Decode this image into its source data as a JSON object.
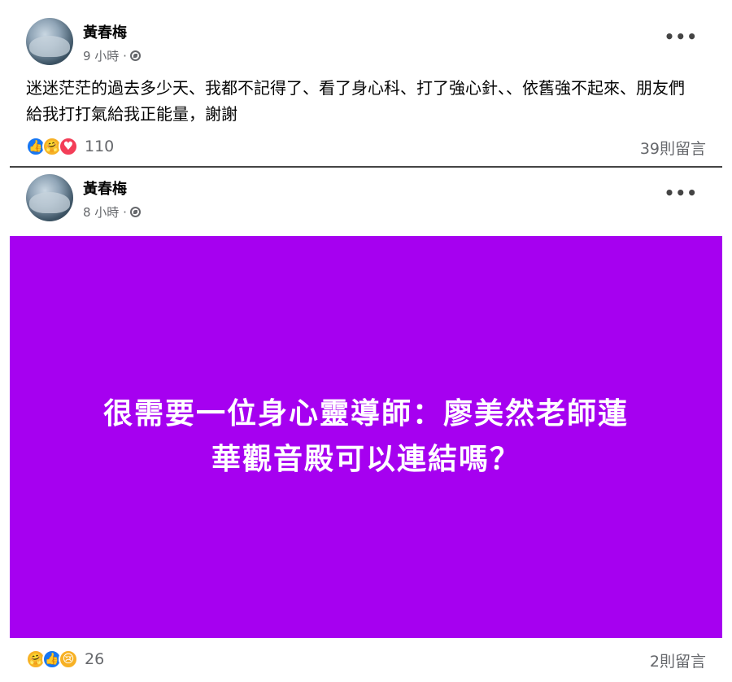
{
  "posts": [
    {
      "author": "黃春梅",
      "time": "9 小時 ·",
      "text": "迷迷茫茫的過去多少天、我都不記得了、看了身心科、打了強心針、、依舊強不起來、朋友們給我打打氣給我正能量，謝謝",
      "reaction_icons": [
        "like-icon",
        "care-icon",
        "love-icon"
      ],
      "reaction_count": "110",
      "comments": "39則留言"
    },
    {
      "author": "黃春梅",
      "time": "8 小時 ·",
      "banner_line1": "很需要一位身心靈導師：廖美然老師蓮",
      "banner_line2": "華觀音殿可以連結嗎？",
      "banner_color": "#a600f0",
      "reaction_icons": [
        "care-icon",
        "like-icon",
        "sad-icon"
      ],
      "reaction_count": "26",
      "comments": "2則留言"
    }
  ],
  "more_label": "•••"
}
